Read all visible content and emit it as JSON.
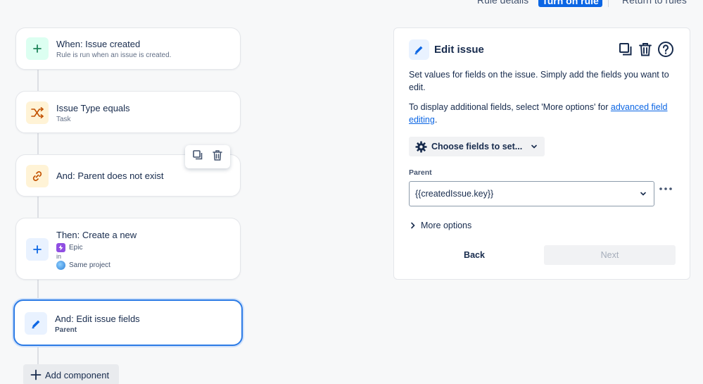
{
  "header": {
    "rule_details_label": "Rule details",
    "turn_on_label": "Turn on rule",
    "return_label": "Return to rules"
  },
  "components": [
    {
      "title": "When: Issue created",
      "subtitle": "Rule is run when an issue is created.",
      "icon": "plus-icon"
    },
    {
      "title": "Issue Type equals",
      "subtitle": "Task",
      "icon": "shuffle-icon"
    },
    {
      "title": "And: Parent does not exist",
      "icon": "link-icon"
    },
    {
      "title": "Then: Create a new",
      "issue_type": "Epic",
      "in_label": "in",
      "project": "Same project",
      "icon": "plus-icon"
    },
    {
      "title": "And: Edit issue fields",
      "subtitle": "Parent",
      "icon": "pencil-icon"
    }
  ],
  "add_component_label": "Add component",
  "panel": {
    "title": "Edit issue",
    "description": "Set values for fields on the issue. Simply add the fields you want to edit.",
    "advanced_prefix": "To display additional fields, select 'More options' for ",
    "advanced_link": "advanced field editing",
    "advanced_suffix": ".",
    "choose_fields_label": "Choose fields to set...",
    "field_label": "Parent",
    "field_value": "{{createdIssue.key}}",
    "more_options_label": "More options",
    "back_label": "Back",
    "next_label": "Next"
  },
  "colors": {
    "accent": "#0c66e4",
    "selected_border": "#2c7be5",
    "trigger_icon_bg": "#dcfff1",
    "condition_icon_bg": "#fff3d6",
    "action_icon_bg": "#e9f2ff",
    "epic": "#904ee2"
  }
}
